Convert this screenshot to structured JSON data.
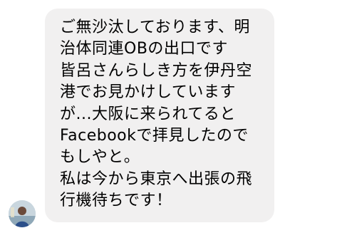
{
  "message": {
    "lines": [
      "ご無沙汰しております、明",
      "治体同連OBの出口です",
      "皆呂さんらしき方を伊丹空",
      "港でお見かけしています",
      "が...大阪に来られてると",
      "Facebookで拝見したので",
      "もしやと。",
      "私は今から東京へ出張の飛",
      "行機待ちです！"
    ]
  },
  "avatar": {
    "icon": "user-photo-avatar",
    "bg_color": "#c9d6de",
    "accent_color": "#2b4f8a"
  },
  "colors": {
    "bubble_bg": "#f1f0f0",
    "text": "#000000",
    "page_bg": "#ffffff"
  }
}
